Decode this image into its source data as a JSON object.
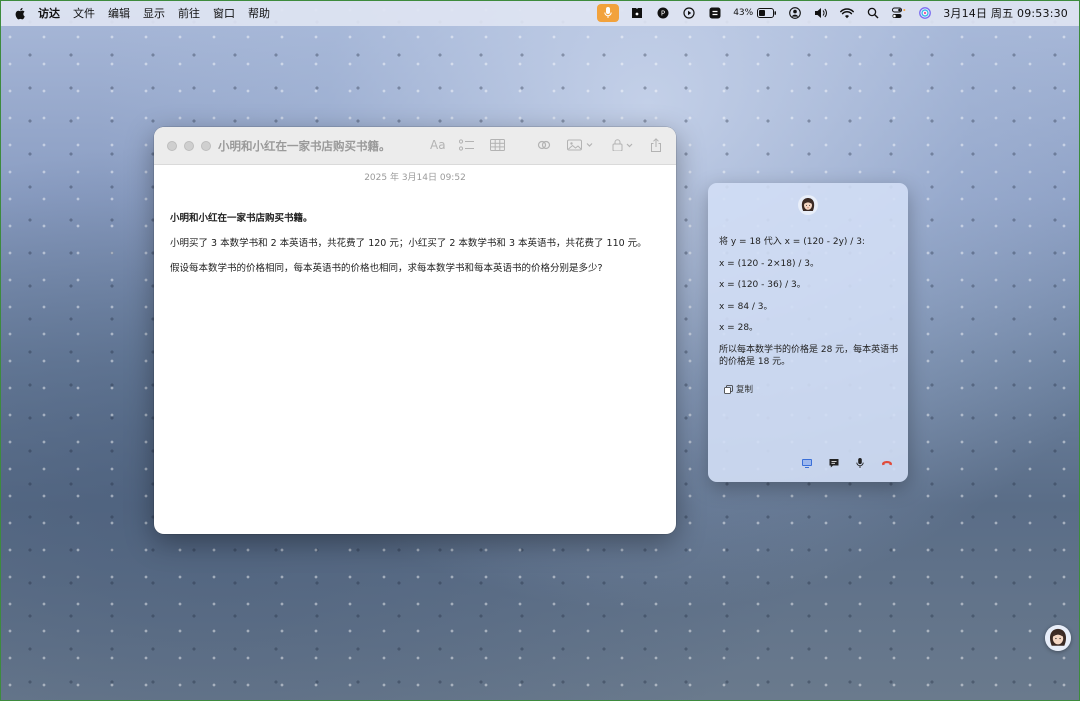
{
  "menubar": {
    "app_name": "访达",
    "menus": [
      "文件",
      "编辑",
      "显示",
      "前往",
      "窗口",
      "帮助"
    ],
    "battery": "43%",
    "clock": "3月14日 周五  09:53:30"
  },
  "notes_window": {
    "title": "小明和小红在一家书店购买书籍。",
    "toolbar_font_label": "Aa",
    "date": "2025 年 3月14日 09:52",
    "paragraphs": [
      "小明和小红在一家书店购买书籍。",
      "小明买了 3 本数学书和 2 本英语书，共花费了 120 元；小红买了 2 本数学书和 3 本英语书，共花费了 110 元。",
      "假设每本数学书的价格相同，每本英语书的价格也相同，求每本数学书和每本英语书的价格分别是多少?"
    ]
  },
  "assistant": {
    "lines": [
      "将 y = 18 代入 x = (120 - 2y) / 3:",
      "x = (120 - 2×18) / 3。",
      "x = (120 - 36) / 3。",
      "x = 84 / 3。",
      "x = 28。",
      "所以每本数学书的价格是 28 元，每本英语书的价格是 18 元。"
    ],
    "copy_label": "复制"
  },
  "colors": {
    "mic_active": "#f2a23c",
    "end_call": "#e04a3a",
    "accent": "#3a6fd8"
  }
}
